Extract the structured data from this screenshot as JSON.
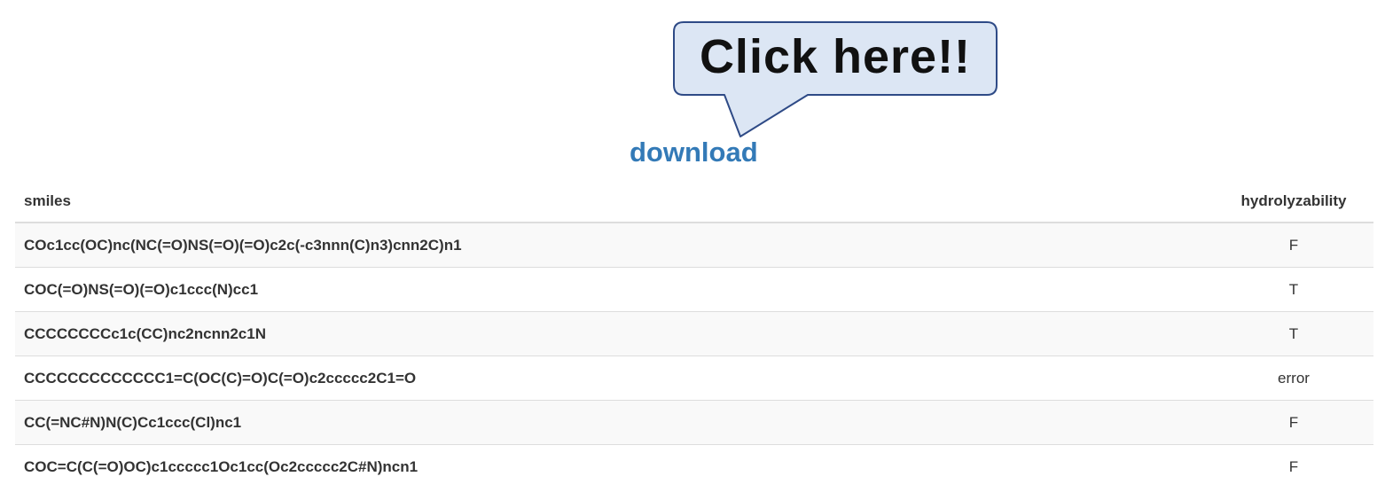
{
  "callout": {
    "text": "Click here!!",
    "fill_color": "#dce6f4",
    "border_color": "#2e4a86"
  },
  "download": {
    "label": "download",
    "color": "#337ab7"
  },
  "table": {
    "headers": {
      "smiles": "smiles",
      "hydrolyzability": "hydrolyzability"
    },
    "rows": [
      {
        "smiles": "COc1cc(OC)nc(NC(=O)NS(=O)(=O)c2c(-c3nnn(C)n3)cnn2C)n1",
        "hydrolyzability": "F"
      },
      {
        "smiles": "COC(=O)NS(=O)(=O)c1ccc(N)cc1",
        "hydrolyzability": "T"
      },
      {
        "smiles": "CCCCCCCCc1c(CC)nc2ncnn2c1N",
        "hydrolyzability": "T"
      },
      {
        "smiles": "CCCCCCCCCCCCC1=C(OC(C)=O)C(=O)c2ccccc2C1=O",
        "hydrolyzability": "error"
      },
      {
        "smiles": "CC(=NC#N)N(C)Cc1ccc(Cl)nc1",
        "hydrolyzability": "F"
      },
      {
        "smiles": "COC=C(C(=O)OC)c1ccccc1Oc1cc(Oc2ccccc2C#N)ncn1",
        "hydrolyzability": "F"
      }
    ]
  }
}
